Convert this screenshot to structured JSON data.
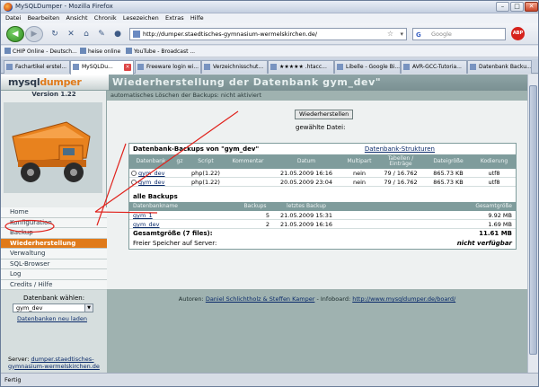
{
  "window": {
    "title": "MySQLDumper - Mozilla Firefox"
  },
  "menu": [
    "Datei",
    "Bearbeiten",
    "Ansicht",
    "Chronik",
    "Lesezeichen",
    "Extras",
    "Hilfe"
  ],
  "url": "http://dumper.staedtisches-gymnasium-wermelskirchen.de/",
  "search_placeholder": "Google",
  "adblock_label": "ABP",
  "bookmarks": [
    "CHIP Online - Deutsch...",
    "heise online",
    "YouTube - Broadcast ..."
  ],
  "tabs": [
    "Fachartikel erstel...",
    "MySQLDu...",
    "Freeware login wi...",
    "Verzeichnisschut...",
    "★★★★★ .htacc...",
    "Libelle - Google Bi...",
    "AVR-GCC-Tutoria...",
    "Datenbank Backu..."
  ],
  "app": {
    "logo_main": "mysql",
    "logo_accent": "dumper",
    "version": "Version 1.22",
    "page_title": "Wiederherstellung der Datenbank gym_dev\"",
    "status_line": "automatisches Löschen der Backups: nicht aktiviert"
  },
  "nav": [
    "Home",
    "Konfiguration",
    "Backup",
    "Wiederherstellung",
    "Verwaltung",
    "SQL-Browser",
    "Log",
    "Credits / Hilfe"
  ],
  "db": {
    "label": "Datenbank wählen:",
    "selected": "gym_dev",
    "reload": "Datenbanken neu laden"
  },
  "server": {
    "label": "Server:",
    "host": "dumper.staedtisches-gymnasium-wermelskirchen.de"
  },
  "restore_button": "Wiederherstellen",
  "chosen_file": "gewählte Datei:",
  "backups": {
    "title": "Datenbank-Backups von \"gym_dev\"",
    "structures_link": "Datenbank-Strukturen",
    "columns": [
      "Datenbank",
      "gz",
      "Script",
      "Kommentar",
      "Datum",
      "Multipart",
      "Tabellen / Einträge",
      "Dateigröße",
      "Kodierung"
    ],
    "rows": [
      [
        "gym_dev",
        "",
        "php(1.22)",
        "",
        "21.05.2009 16:16",
        "nein",
        "79 / 16.762",
        "865.73 KB",
        "utf8"
      ],
      [
        "gym_dev",
        "",
        "php(1.22)",
        "",
        "20.05.2009 23:04",
        "nein",
        "79 / 16.762",
        "865.73 KB",
        "utf8"
      ]
    ]
  },
  "all_backups": {
    "title": "alle Backups",
    "columns": [
      "Datenbankname",
      "Backups",
      "letztes Backup",
      "Gesamtgröße"
    ],
    "rows": [
      [
        "gym_1",
        "5",
        "21.05.2009 15:31",
        "9.92 MB"
      ],
      [
        "gym_dev",
        "2",
        "21.05.2009 16:16",
        "1.69 MB"
      ]
    ],
    "total_label": "Gesamtgröße (7 files):",
    "total_value": "11.61 MB",
    "free_label": "Freier Speicher auf Server:",
    "free_value": "nicht verfügbar"
  },
  "footer": {
    "authors_label": "Autoren:",
    "authors": "Daniel Schlichtholz & Steffen Kamper",
    "infoboard_label": "- Infoboard:",
    "infoboard_url": "http://www.mysqldumper.de/board/"
  },
  "statusbar": "Fertig",
  "colors": {
    "accent": "#e07a1a",
    "table_head": "#7f9c9c",
    "annotation": "#e0221c"
  }
}
